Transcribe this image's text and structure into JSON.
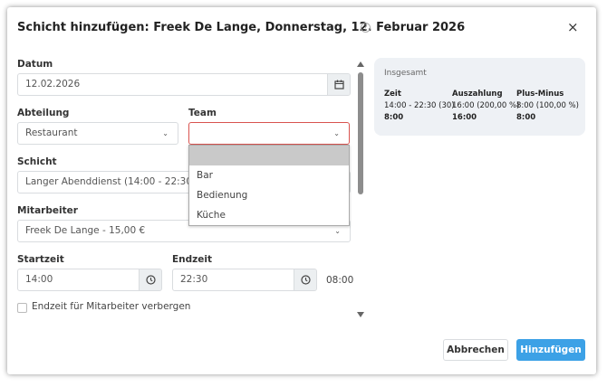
{
  "modal": {
    "title": "Schicht hinzufügen: Freek De Lange, Donnerstag, 12. Februar 2026",
    "help_icon": "?",
    "close_icon": "×"
  },
  "form": {
    "date": {
      "label": "Datum",
      "value": "12.02.2026",
      "icon": "calendar-icon"
    },
    "department": {
      "label": "Abteilung",
      "value": "Restaurant"
    },
    "team": {
      "label": "Team",
      "value": "",
      "options": [
        "",
        "Bar",
        "Bedienung",
        "Küche"
      ]
    },
    "shift": {
      "label": "Schicht",
      "value": "Langer Abenddienst (14:00 - 22:30 )"
    },
    "employee": {
      "label": "Mitarbeiter",
      "value": "Freek De Lange - 15,00 €"
    },
    "start": {
      "label": "Startzeit",
      "value": "14:00",
      "icon": "clock-icon"
    },
    "end": {
      "label": "Endzeit",
      "value": "22:30",
      "icon": "clock-icon"
    },
    "duration": "08:00",
    "hide_end": {
      "label": "Endzeit für Mitarbeiter verbergen",
      "checked": false
    }
  },
  "summary": {
    "title": "Insgesamt",
    "columns": [
      {
        "header": "Zeit",
        "line1": "14:00 - 22:30 (30)",
        "line2": "8:00"
      },
      {
        "header": "Auszahlung",
        "line1": "16:00 (200,00 %)",
        "line2": "16:00"
      },
      {
        "header": "Plus-Minus",
        "line1": "8:00 (100,00 %)",
        "line2": "8:00"
      }
    ]
  },
  "buttons": {
    "cancel": "Abbrechen",
    "add": "Hinzufügen"
  },
  "colors": {
    "primary": "#3ca1e6",
    "error_border": "#d9534f",
    "summary_bg": "#eef1f5"
  }
}
